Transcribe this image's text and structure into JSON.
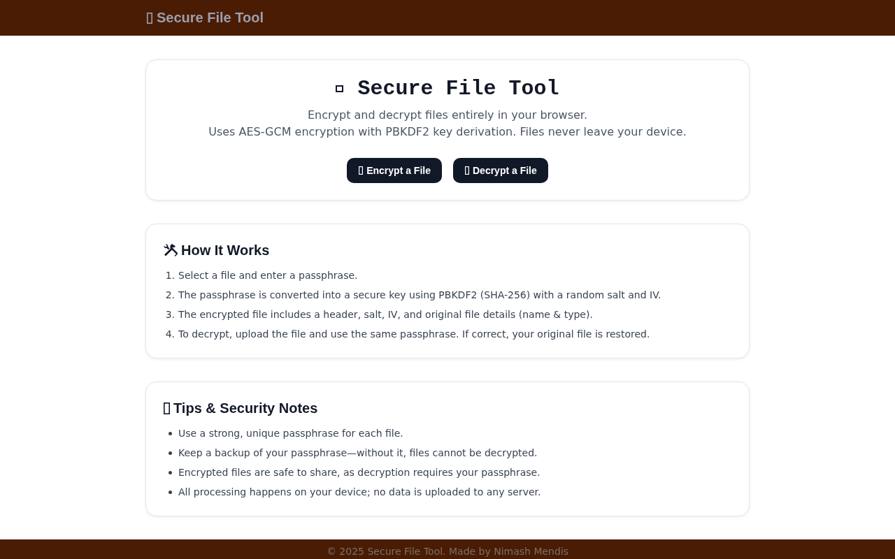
{
  "header": {
    "title": "Secure File Tool"
  },
  "hero": {
    "title": "Secure File Tool",
    "subtitle_lines": [
      "Encrypt and decrypt files entirely in your browser.",
      "Uses AES-GCM encryption with PBKDF2 key derivation. Files never leave your device."
    ],
    "buttons": [
      {
        "label": "Encrypt a File"
      },
      {
        "label": "Decrypt a File"
      }
    ]
  },
  "how_it_works": {
    "heading": "How It Works",
    "steps": [
      {
        "number": "1.",
        "text": "Select a file and enter a passphrase."
      },
      {
        "number": "2.",
        "text": "The passphrase is converted into a secure key using PBKDF2 (SHA-256) with a random salt and IV."
      },
      {
        "number": "3.",
        "text": "The encrypted file includes a header, salt, IV, and original file details (name & type)."
      },
      {
        "number": "4.",
        "text": "To decrypt, upload the file and use the same passphrase. If correct, your original file is restored."
      }
    ]
  },
  "tips": {
    "heading": "Tips & Security Notes",
    "items": [
      "Use a strong, unique passphrase for each file.",
      "Keep a backup of your passphrase—without it, files cannot be decrypted.",
      "Encrypted files are safe to share, as decryption requires your passphrase.",
      "All processing happens on your device; no data is uploaded to any server."
    ]
  },
  "footer": {
    "text": "© 2025 Secure File Tool. Made by Nimash Mendis"
  }
}
